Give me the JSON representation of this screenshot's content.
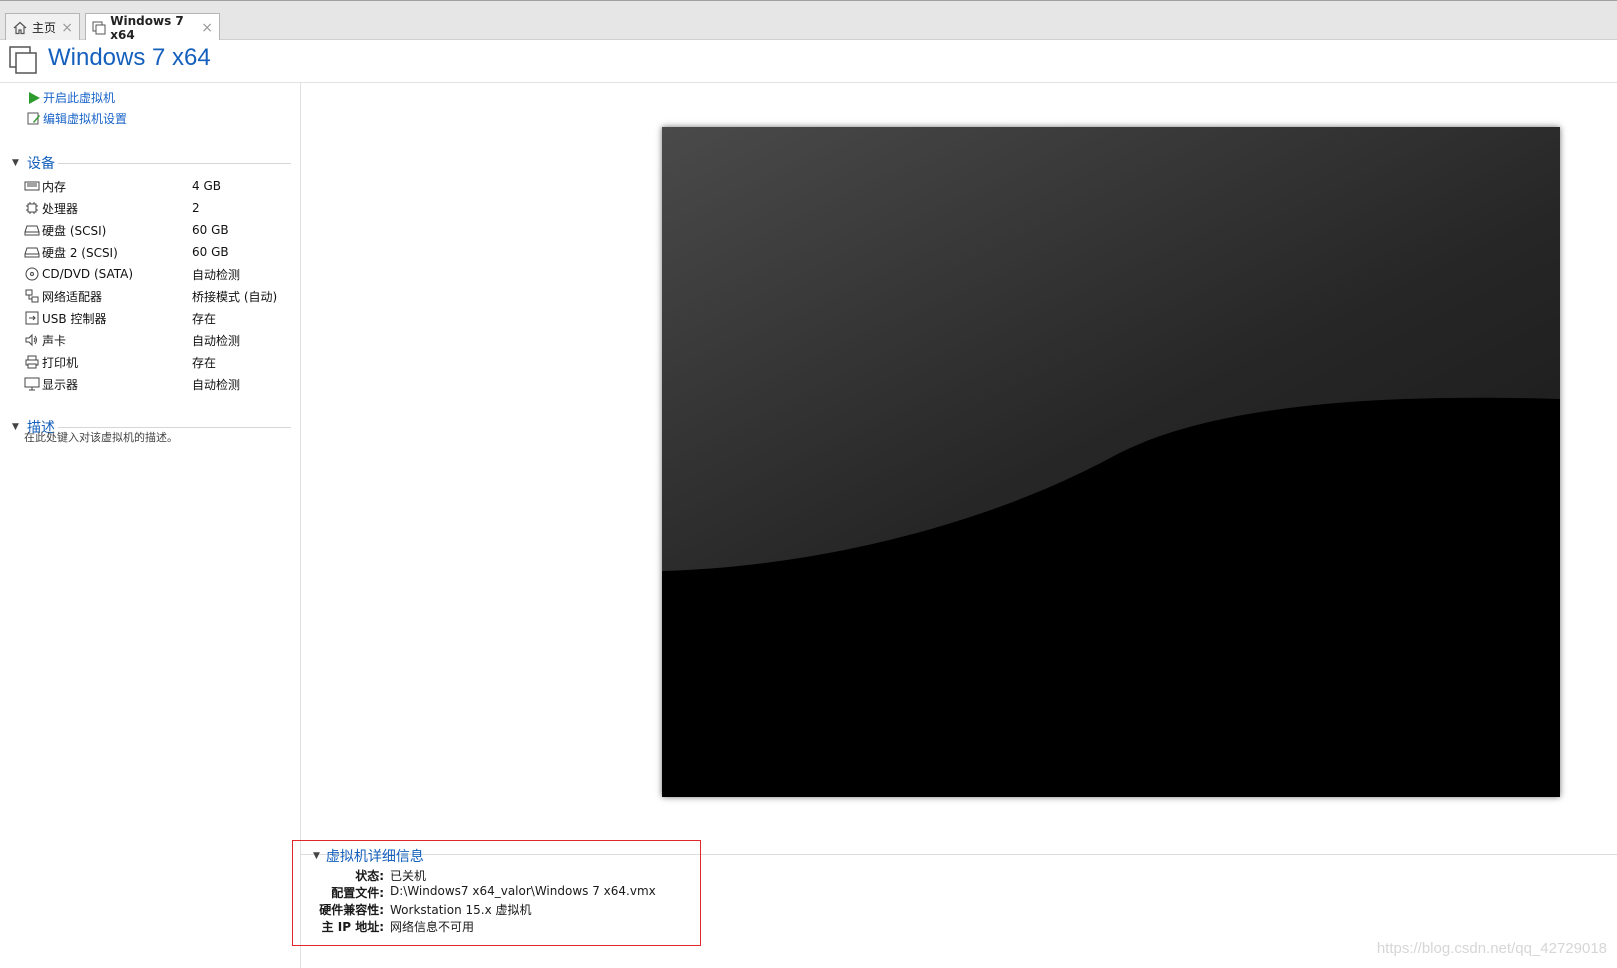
{
  "tabs": [
    {
      "label": "主页",
      "icon": "home-icon"
    },
    {
      "label": "Windows 7 x64",
      "icon": "vm-icon"
    }
  ],
  "header": {
    "title": "Windows 7 x64"
  },
  "actions": {
    "power_on": "开启此虚拟机",
    "edit_settings": "编辑虚拟机设置"
  },
  "devices": {
    "heading": "设备",
    "items": [
      {
        "label": "内存",
        "value": "4 GB",
        "icon": "memory-icon"
      },
      {
        "label": "处理器",
        "value": "2",
        "icon": "cpu-icon"
      },
      {
        "label": "硬盘 (SCSI)",
        "value": "60 GB",
        "icon": "harddisk-icon"
      },
      {
        "label": "硬盘 2 (SCSI)",
        "value": "60 GB",
        "icon": "harddisk-icon"
      },
      {
        "label": "CD/DVD (SATA)",
        "value": "自动检测",
        "icon": "cd-dvd-icon"
      },
      {
        "label": "网络适配器",
        "value": "桥接模式 (自动)",
        "icon": "network-icon"
      },
      {
        "label": "USB 控制器",
        "value": "存在",
        "icon": "usb-icon"
      },
      {
        "label": "声卡",
        "value": "自动检测",
        "icon": "speaker-icon"
      },
      {
        "label": "打印机",
        "value": "存在",
        "icon": "printer-icon"
      },
      {
        "label": "显示器",
        "value": "自动检测",
        "icon": "monitor-icon"
      }
    ]
  },
  "description": {
    "heading": "描述",
    "placeholder": "在此处键入对该虚拟机的描述。"
  },
  "details": {
    "heading": "虚拟机详细信息",
    "rows": [
      {
        "key": "状态:",
        "value": "已关机"
      },
      {
        "key": "配置文件:",
        "value": "D:\\Windows7 x64_valor\\Windows 7 x64.vmx"
      },
      {
        "key": "硬件兼容性:",
        "value": "Workstation 15.x 虚拟机"
      },
      {
        "key": "主 IP 地址:",
        "value": "网络信息不可用"
      }
    ]
  },
  "watermark": "https://blog.csdn.net/qq_42729018",
  "colors": {
    "accent": "#1560bd",
    "link": "#1a64c8",
    "highlight": "#e0282a",
    "play": "#2e9b2e"
  }
}
